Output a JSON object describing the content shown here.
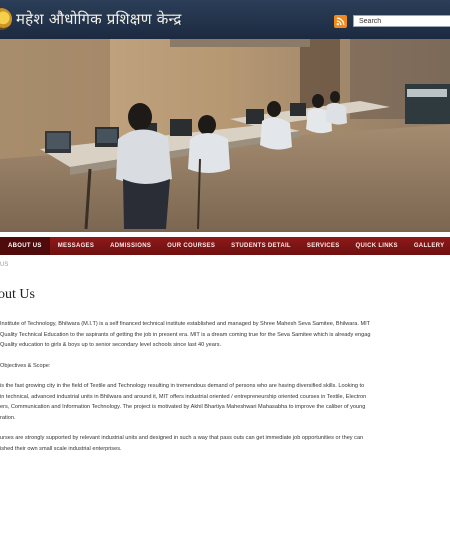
{
  "header": {
    "site_title": "महेश औधोगिक प्रशिक्षण केन्द्र",
    "search_value": "Search"
  },
  "nav": {
    "items": [
      {
        "label": "ABOUT US",
        "active": true
      },
      {
        "label": "MESSAGES"
      },
      {
        "label": "ADMISSIONS"
      },
      {
        "label": "OUR COURSES"
      },
      {
        "label": "STUDENTS DETAIL"
      },
      {
        "label": "SERVICES"
      },
      {
        "label": "QUICK LINKS"
      },
      {
        "label": "GALLERY"
      }
    ]
  },
  "breadcrumb": "US",
  "page": {
    "title": "out Us",
    "para1_line1": "Institute of Technology, Bhilwara (M.I.T) is a self financed technical institute established and managed by Shree Mahesh Seva Samitee, Bhilwara. MIT",
    "para1_line2": "Quality Technical Education to the aspirants of getting the job in present era. MIT is a dream coming true for the Seva Samitee which is already engag",
    "para1_line3": "Quality education to girls & boys up to senior secondary level schools since last 40 years.",
    "heading": "Objectives & Scope:",
    "para2_line1": "is the fast growing city in the field of Textile and Technology resulting in tremendous demand of persons who are having diversified skills. Looking to",
    "para2_line2": "in technical, advanced industrial units in Bhilwara and around it, MIT offers industrial oriented / entrepreneurship oriented courses in Textile, Electron",
    "para2_line3": "ers, Communication and Information Technology. The project is motivated by Akhil Bhartiya Maheshwari Mahasabha to improve the caliber of young",
    "para2_line4": "ration.",
    "para3_line1": "urses are strongly supported by relevant industrial units and designed in such a way that pass outs can get immediate job opportunities or they can",
    "para3_line2": "ished their own small scale industrial enterprises."
  }
}
